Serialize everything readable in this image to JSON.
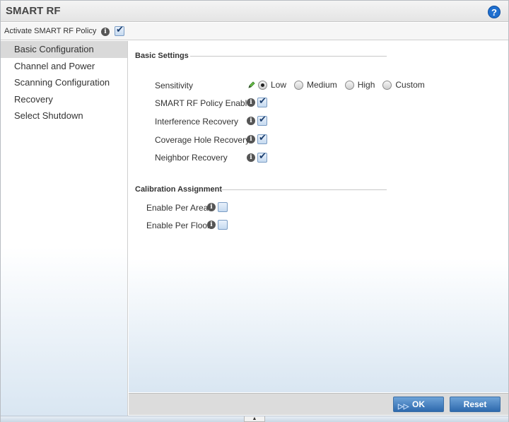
{
  "window": {
    "title": "SMART RF"
  },
  "activate": {
    "label": "Activate SMART RF Policy",
    "checked": true
  },
  "sidebar": {
    "items": [
      {
        "label": "Basic Configuration",
        "active": true
      },
      {
        "label": "Channel and Power",
        "active": false
      },
      {
        "label": "Scanning Configuration",
        "active": false
      },
      {
        "label": "Recovery",
        "active": false
      },
      {
        "label": "Select Shutdown",
        "active": false
      }
    ]
  },
  "basic_settings": {
    "header": "Basic Settings",
    "sensitivity": {
      "label": "Sensitivity",
      "options": [
        "Low",
        "Medium",
        "High",
        "Custom"
      ],
      "selected": "Low"
    },
    "policy_enable": {
      "label": "SMART RF Policy Enable",
      "checked": true
    },
    "interference_recovery": {
      "label": "Interference Recovery",
      "checked": true
    },
    "coverage_hole_recovery": {
      "label": "Coverage Hole Recovery",
      "checked": true
    },
    "neighbor_recovery": {
      "label": "Neighbor Recovery",
      "checked": true
    }
  },
  "calibration": {
    "header": "Calibration Assignment",
    "per_area": {
      "label": "Enable Per Area",
      "checked": false
    },
    "per_floor": {
      "label": "Enable Per Floor",
      "checked": false
    }
  },
  "buttons": {
    "ok": "OK",
    "reset": "Reset"
  },
  "icons": {
    "help": "?",
    "info": "i",
    "ok_glyph": "▷▷",
    "collapse": "▲"
  },
  "colors": {
    "accent": "#2d69ad",
    "help": "#1e6fcf"
  }
}
